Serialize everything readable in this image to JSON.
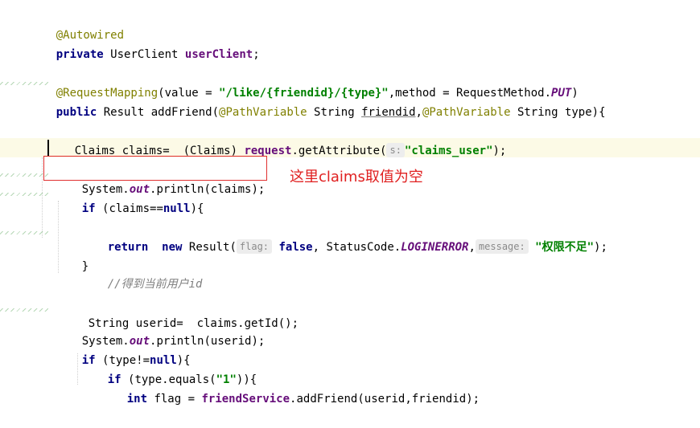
{
  "code": {
    "l1_annot": "@Autowired",
    "l2_kw": "private",
    "l2_type": "UserClient",
    "l2_field": "userClient",
    "l2_end": ";",
    "l4_annot": "@RequestMapping",
    "l4_a": "(value = ",
    "l4_str": "\"/like/{friendid}/{type}\"",
    "l4_b": ",method = RequestMethod.",
    "l4_put": "PUT",
    "l4_c": ")",
    "l5_kw": "public",
    "l5_a": "Result addFriend(",
    "l5_ann1": "@PathVariable",
    "l5_b": "String ",
    "l5_param": "friendid",
    "l5_comma": ",",
    "l5_ann2": "@PathVariable",
    "l5_c": "String type){",
    "l7_a": "Claims claims=  (Claims) ",
    "l7_req": "request",
    "l7_b": ".getAttribute(",
    "l7_hint": "s:",
    "l7_str": "\"claims_user\"",
    "l7_c": ");",
    "l9_a": "System.",
    "l9_out": "out",
    "l9_b": ".println(claims);",
    "l10_kw": "if",
    "l10_a": "(claims==",
    "l10_null": "null",
    "l10_b": "){",
    "l12_ret": "return",
    "l12_new": "new",
    "l12_a": "Result(",
    "l12_hint1": "flag:",
    "l12_false": "false",
    "l12_b": ", StatusCode.",
    "l12_const": "LOGINERROR",
    "l12_comma": ",",
    "l12_hint2": "message:",
    "l12_str": "\"权限不足\"",
    "l12_c": ");",
    "l13": "}",
    "l14_comment": "//得到当前用户id",
    "l16_a": "String userid=  claims.getId();",
    "l17_a": "System.",
    "l17_out": "out",
    "l17_b": ".println(userid);",
    "l18_kw": "if",
    "l18_a": "(type!=",
    "l18_null": "null",
    "l18_b": "){",
    "l19_kw": "if",
    "l19_a": "(type.equals(",
    "l19_str": "\"1\"",
    "l19_b": ")){",
    "l20_kw": "int",
    "l20_a": "flag = ",
    "l20_field": "friendService",
    "l20_b": ".addFriend(userid,friendid);"
  },
  "annotation_note": "这里claims取值为空",
  "colors": {
    "keyword": "#000080",
    "string": "#008000",
    "annotation": "#808000",
    "field": "#660e7a",
    "note": "#e02020"
  }
}
